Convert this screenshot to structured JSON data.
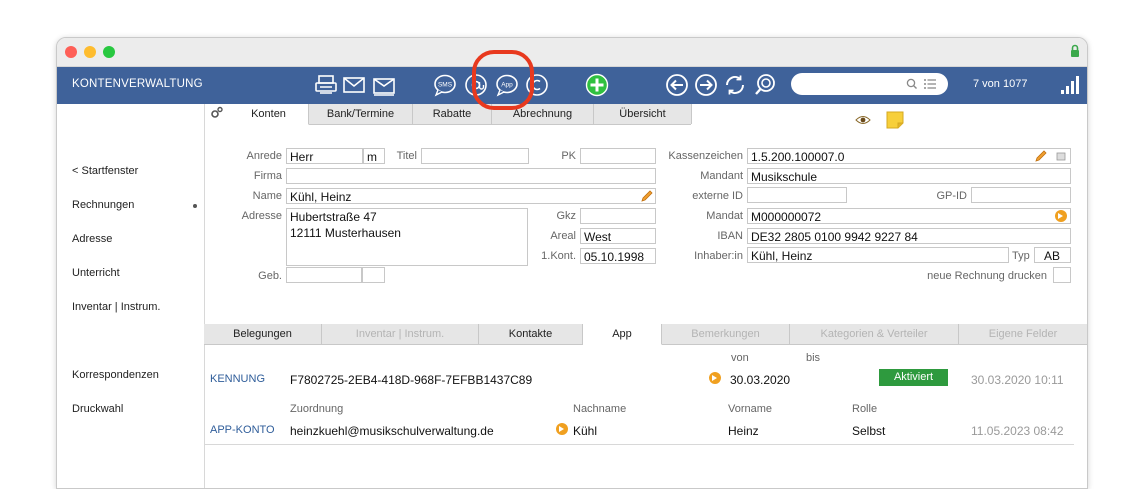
{
  "toolbar": {
    "title": "KONTENVERWALTUNG",
    "sms_label": "SMS",
    "app_label": "App",
    "record_count": "7 von 1077"
  },
  "sidebar": {
    "items": [
      {
        "label": "< Startfenster"
      },
      {
        "label": "Rechnungen"
      },
      {
        "label": "Adresse"
      },
      {
        "label": "Unterricht"
      },
      {
        "label": "Inventar | Instrum."
      },
      {
        "label": "Korrespondenzen"
      },
      {
        "label": "Druckwahl"
      }
    ]
  },
  "top_tabs": [
    {
      "label": "Konten"
    },
    {
      "label": "Bank/Termine"
    },
    {
      "label": "Rabatte"
    },
    {
      "label": "Abrechnung"
    },
    {
      "label": "Übersicht"
    }
  ],
  "form": {
    "anrede_label": "Anrede",
    "anrede": "Herr",
    "gender": "m",
    "titel_label": "Titel",
    "titel": "",
    "pk_label": "PK",
    "pk": "",
    "firma_label": "Firma",
    "firma": "",
    "name_label": "Name",
    "name": "Kühl, Heinz",
    "adresse_label": "Adresse",
    "adresse": "Hubertstraße 47\n12111 Musterhausen",
    "gkz_label": "Gkz",
    "gkz": "",
    "areal_label": "Areal",
    "areal": "West",
    "kont_label": "1.Kont.",
    "kont": "05.10.1998",
    "geb_label": "Geb.",
    "geb": "",
    "kassenzeichen_label": "Kassenzeichen",
    "kassenzeichen": "1.5.200.100007.0",
    "mandant_label": "Mandant",
    "mandant": "Musikschule",
    "externe_id_label": "externe ID",
    "externe_id": "",
    "gp_id_label": "GP-ID",
    "gp_id": "",
    "mandat_label": "Mandat",
    "mandat": "M000000072",
    "iban_label": "IBAN",
    "iban": "DE32 2805 0100 9942 9227 84",
    "inhaber_label": "Inhaber:in",
    "inhaber": "Kühl, Heinz",
    "typ_label": "Typ",
    "typ": "AB",
    "neue_rechnung_label": "neue Rechnung drucken"
  },
  "bottom_tabs": [
    {
      "label": "Belegungen"
    },
    {
      "label": "Inventar | Instrum."
    },
    {
      "label": "Kontakte"
    },
    {
      "label": "App"
    },
    {
      "label": "Bemerkungen"
    },
    {
      "label": "Kategorien & Verteiler"
    },
    {
      "label": "Eigene Felder"
    }
  ],
  "app_panel": {
    "von_label": "von",
    "bis_label": "bis",
    "kennung_label": "KENNUNG",
    "kennung_value": "F7802725-2EB4-418D-968F-7EFBB1437C89",
    "von_date": "30.03.2020",
    "status": "Aktiviert",
    "kennung_timestamp": "30.03.2020 10:11",
    "zuordnung_label": "Zuordnung",
    "nachname_label": "Nachname",
    "vorname_label": "Vorname",
    "rolle_label": "Rolle",
    "appkonto_label": "APP-KONTO",
    "email": "heinzkuehl@musikschulverwaltung.de",
    "nachname": "Kühl",
    "vorname": "Heinz",
    "rolle": "Selbst",
    "appkonto_timestamp": "11.05.2023 08:42"
  },
  "colors": {
    "toolbar_bg": "#3f629a",
    "status_green": "#2e9a3e",
    "highlight_red": "#e8391e",
    "link_blue": "#2f5d9a",
    "accent_orange": "#f0a020"
  }
}
